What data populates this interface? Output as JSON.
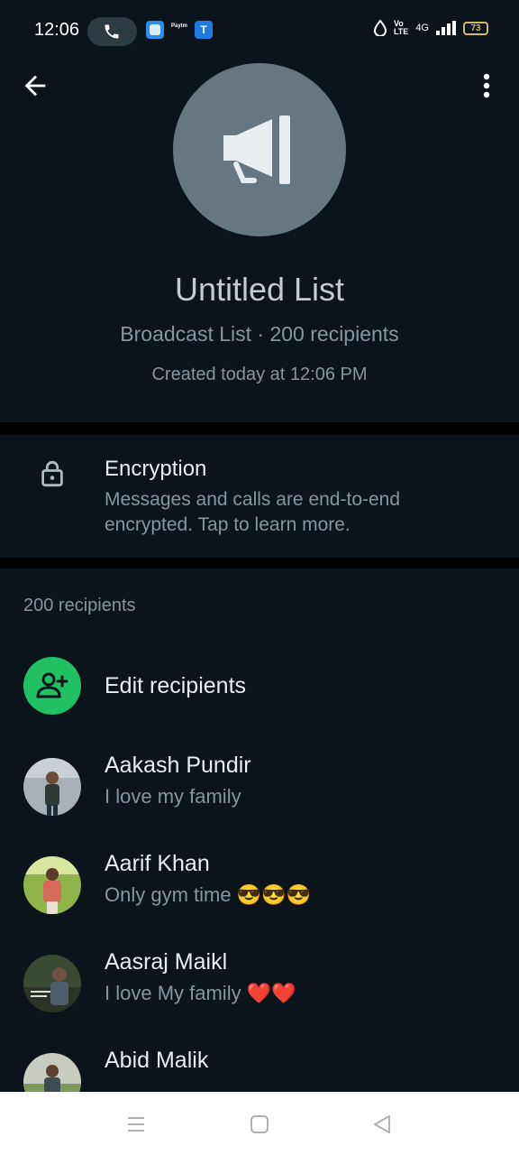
{
  "status_bar": {
    "time": "12:06",
    "notification_icons": [
      "messenger-icon",
      "paytm-business-icon",
      "t-app-icon"
    ],
    "paytm_label": "Paytm",
    "battery_level": "73",
    "network_label": "4G"
  },
  "header": {
    "title": "Untitled List",
    "subtitle": "Broadcast List · 200 recipients",
    "created": "Created today at 12:06 PM"
  },
  "encryption": {
    "title": "Encryption",
    "description": "Messages and calls are end-to-end encrypted. Tap to learn more."
  },
  "recipients": {
    "count_label": "200 recipients",
    "edit_label": "Edit recipients",
    "contacts": [
      {
        "name": "Aakash Pundir",
        "status": "I love my family"
      },
      {
        "name": "Aarif Khan",
        "status": "Only gym time 😎😎😎"
      },
      {
        "name": "Aasraj Maikl",
        "status": "I love My family ❤️❤️"
      },
      {
        "name": "Abid Malik",
        "status": ""
      }
    ]
  },
  "colors": {
    "background": "#0b141a",
    "accent_green": "#21c063",
    "avatar_gray": "#667781",
    "secondary_text": "#8696a0"
  }
}
